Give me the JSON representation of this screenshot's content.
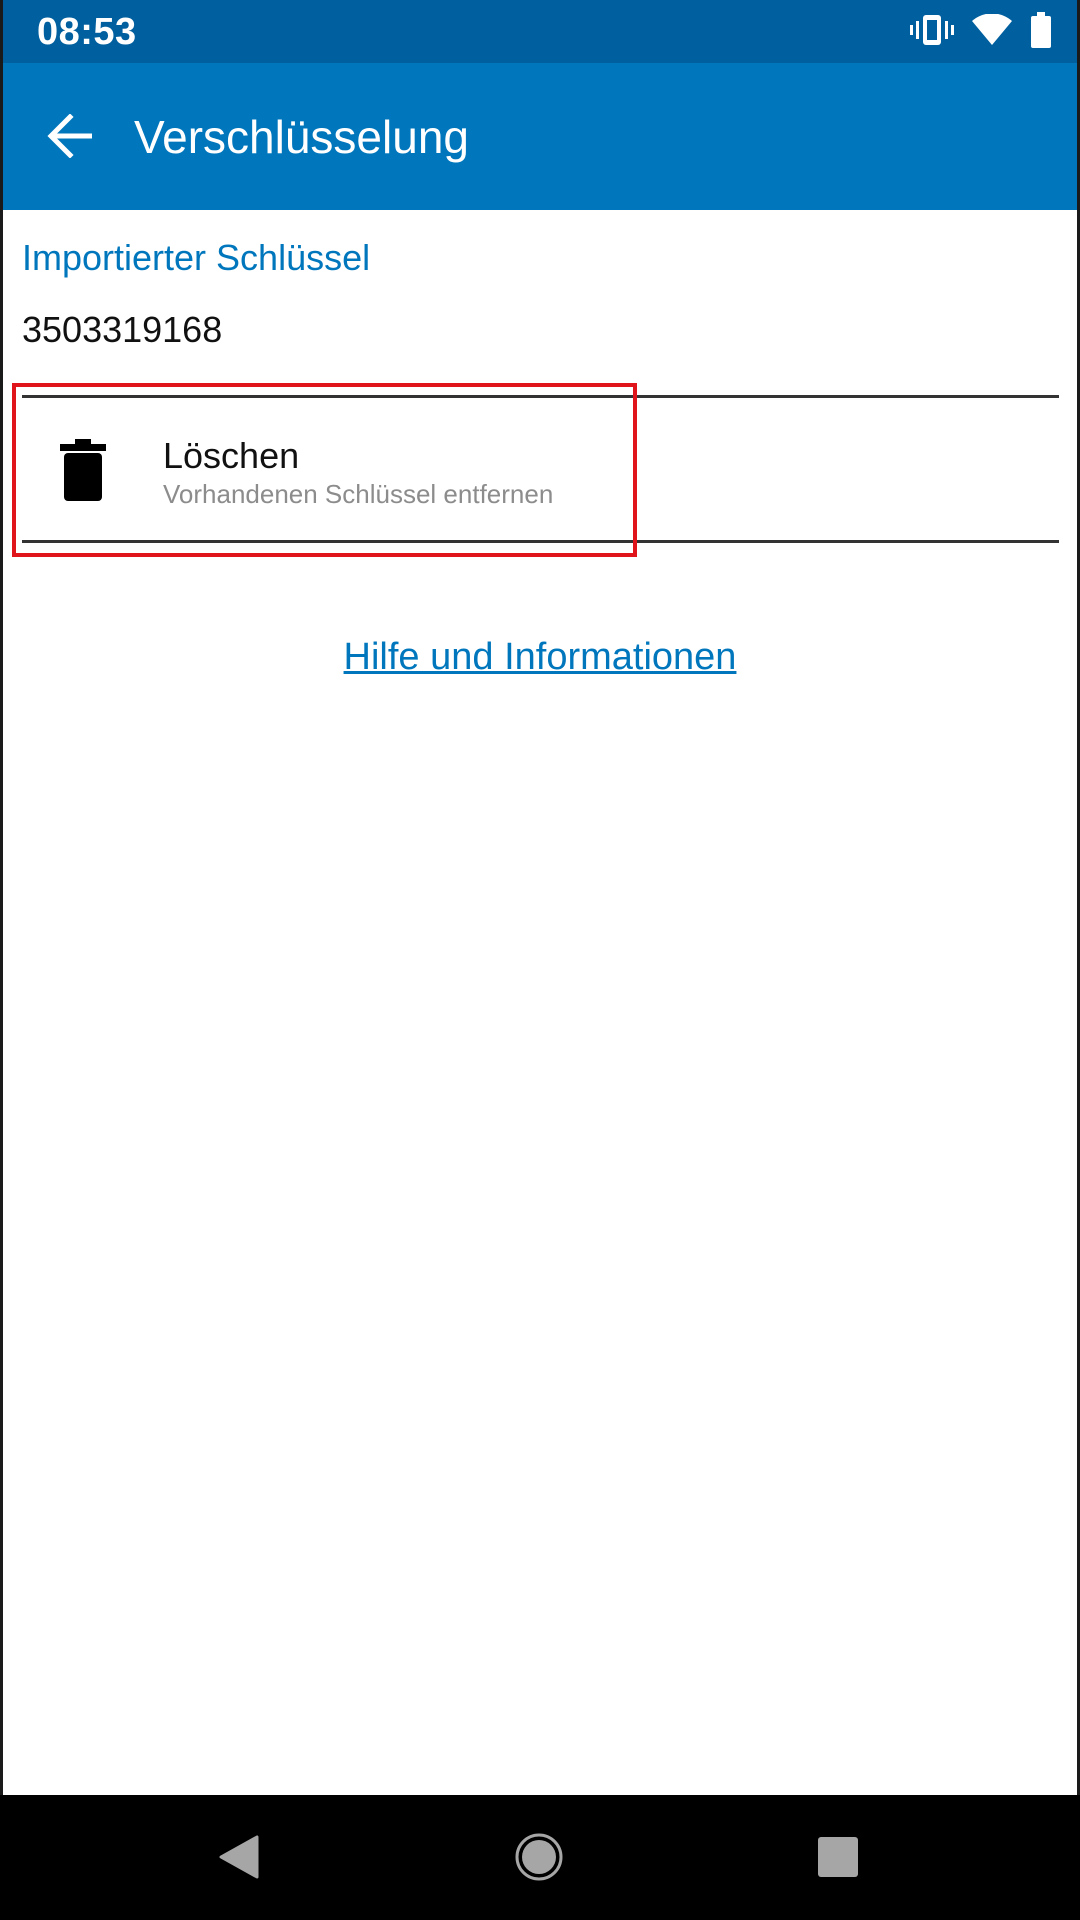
{
  "status_bar": {
    "time": "08:53",
    "icons": [
      "vibrate-icon",
      "wifi-icon",
      "battery-icon"
    ]
  },
  "app_bar": {
    "title": "Verschlüsselung",
    "back_icon": "arrow-back-icon",
    "background_color": "#0077bd",
    "status_color": "#005f9e"
  },
  "key_section": {
    "header": "Importierter Schlüssel",
    "value": "3503319168"
  },
  "delete_item": {
    "icon": "trash-icon",
    "title": "Löschen",
    "subtitle": "Vorhandenen Schlüssel entfernen"
  },
  "help_link": {
    "label": "Hilfe und Informationen"
  },
  "highlight_color": "#e0141b",
  "nav_bar": {
    "buttons": [
      "nav-back-icon",
      "nav-home-icon",
      "nav-recents-icon"
    ]
  }
}
